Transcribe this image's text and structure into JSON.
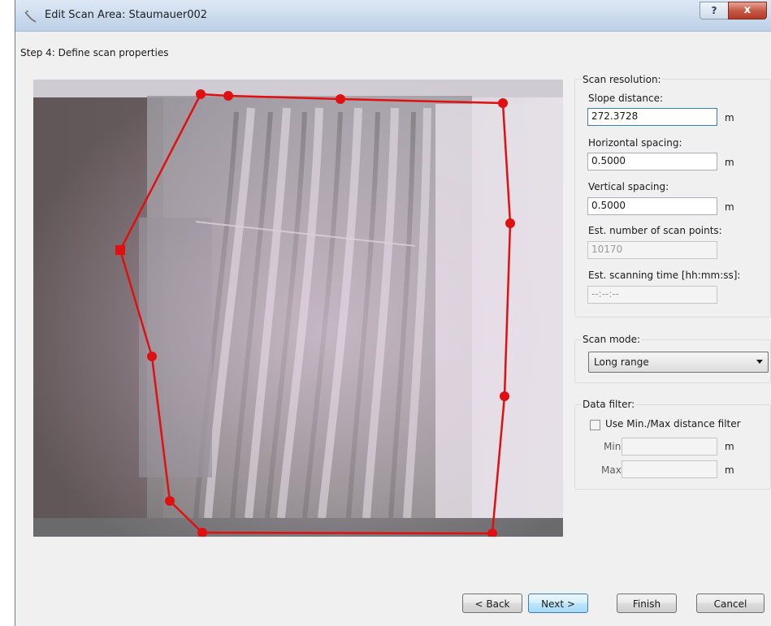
{
  "window": {
    "title": "Edit Scan Area: Staumauer002",
    "help_label": "?",
    "close_label": "x"
  },
  "step_label": "Step 4:  Define scan properties",
  "scan_resolution": {
    "title": "Scan resolution:",
    "slope_distance": {
      "label": "Slope distance:",
      "value": "272.3728",
      "unit": "m"
    },
    "horizontal_spacing": {
      "label": "Horizontal spacing:",
      "value": "0.5000",
      "unit": "m"
    },
    "vertical_spacing": {
      "label": "Vertical spacing:",
      "value": "0.5000",
      "unit": "m"
    },
    "est_points": {
      "label": "Est. number of scan points:",
      "value": "10170"
    },
    "est_time": {
      "label": "Est. scanning time [hh:mm:ss]:",
      "value": "--:--:--"
    }
  },
  "scan_mode": {
    "title": "Scan mode:",
    "selected": "Long range"
  },
  "data_filter": {
    "title": "Data filter:",
    "checkbox_label": "Use Min./Max distance filter",
    "checked": false,
    "min_label": "Min:",
    "max_label": "Max:",
    "min_unit": "m",
    "max_unit": "m"
  },
  "buttons": {
    "back": "< Back",
    "next": "Next >",
    "finish": "Finish",
    "cancel": "Cancel"
  },
  "colors": {
    "scan_polygon": "#e01010",
    "accent_border": "#3c7fb1"
  }
}
